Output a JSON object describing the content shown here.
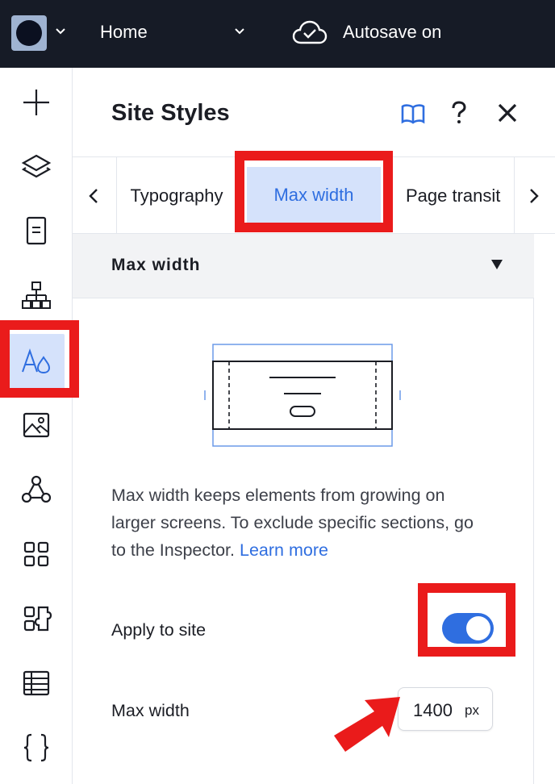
{
  "topbar": {
    "page_name": "Home",
    "autosave_label": "Autosave on"
  },
  "panel": {
    "title": "Site Styles",
    "tabs": [
      "Typography",
      "Max width",
      "Page transit"
    ],
    "active_tab": "Max width",
    "section_title": "Max width",
    "description": "Max width keeps elements from growing on larger screens. To exclude specific sections, go to the Inspector.",
    "learn_more": "Learn more",
    "apply_label": "Apply to site",
    "apply_enabled": true,
    "max_width_label": "Max width",
    "max_width_value": "1400",
    "max_width_unit": "px"
  },
  "colors": {
    "topbar_bg": "#161b26",
    "accent": "#2f6ee0",
    "active_bg": "#d5e2fb",
    "annotation_red": "#ea1b1b"
  },
  "icons": {
    "rail": [
      "plus-icon",
      "layers-icon",
      "page-icon",
      "sitemap-icon",
      "site-styles-icon",
      "image-icon",
      "apps-connect-icon",
      "apps-grid-icon",
      "extensions-icon",
      "table-icon",
      "code-braces-icon"
    ],
    "header": [
      "book-icon",
      "help-icon",
      "close-icon"
    ]
  }
}
